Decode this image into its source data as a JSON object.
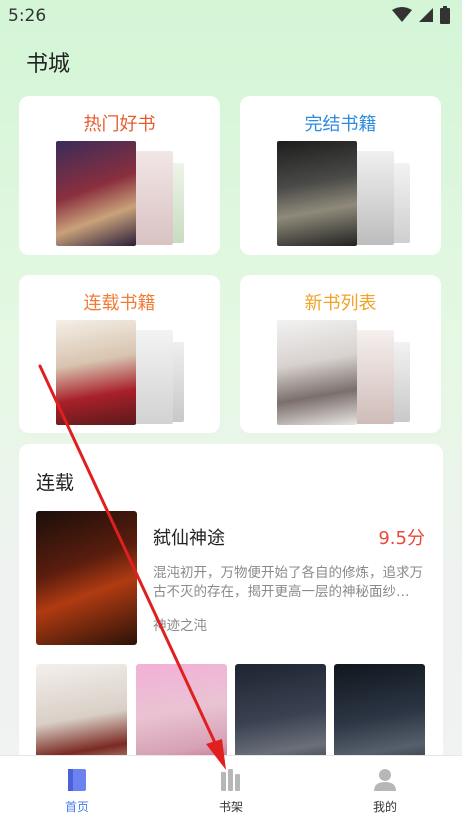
{
  "status": {
    "time": "5:26"
  },
  "page_title": "书城",
  "categories": [
    {
      "label": "热门好书",
      "color": "#e85a2f"
    },
    {
      "label": "完结书籍",
      "color": "#2d8be0"
    },
    {
      "label": "连载书籍",
      "color": "#f07b3a"
    },
    {
      "label": "新书列表",
      "color": "#f0a328"
    }
  ],
  "serial": {
    "heading": "连载",
    "book": {
      "title": "弑仙神途",
      "score": "9.5分",
      "description": "混沌初开，万物便开始了各自的修炼，追求万古不灭的存在，揭开更高一层的神秘面纱…",
      "author": "神迹之沌"
    }
  },
  "bottom_nav": [
    {
      "label": "首页",
      "icon": "book-icon",
      "active": true
    },
    {
      "label": "书架",
      "icon": "bookshelf-icon",
      "active": false
    },
    {
      "label": "我的",
      "icon": "person-icon",
      "active": false
    }
  ],
  "colors": {
    "accent": "#4a7cf0",
    "score": "#e8493a",
    "arrow": "#e02020"
  }
}
